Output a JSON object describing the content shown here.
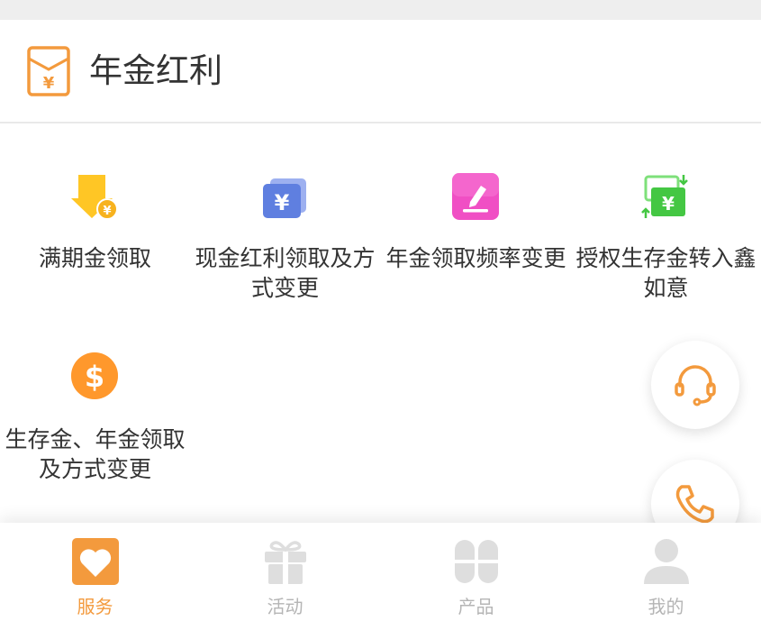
{
  "header": {
    "title": "年金红利",
    "icon": "red-envelope-yuan-icon"
  },
  "services": [
    {
      "label": "满期金领取",
      "icon": "arrow-down-coin-icon"
    },
    {
      "label": "现金红利领取及方式变更",
      "icon": "yuan-cards-icon"
    },
    {
      "label": "年金领取频率变更",
      "icon": "edit-pen-icon"
    },
    {
      "label": "授权生存金转入鑫如意",
      "icon": "transfer-yuan-icon"
    },
    {
      "label": "生存金、年金领取及方式变更",
      "icon": "dollar-coin-icon"
    }
  ],
  "floating": {
    "service_icon": "headset-icon",
    "phone_icon": "phone-icon"
  },
  "tabbar": [
    {
      "label": "服务",
      "icon": "heart-icon",
      "active": true
    },
    {
      "label": "活动",
      "icon": "gift-icon",
      "active": false
    },
    {
      "label": "产品",
      "icon": "clover-grid-icon",
      "active": false
    },
    {
      "label": "我的",
      "icon": "user-icon",
      "active": false
    }
  ],
  "colors": {
    "accent": "#f39a3d",
    "inactive": "#b5b5b5",
    "text": "#333333"
  }
}
